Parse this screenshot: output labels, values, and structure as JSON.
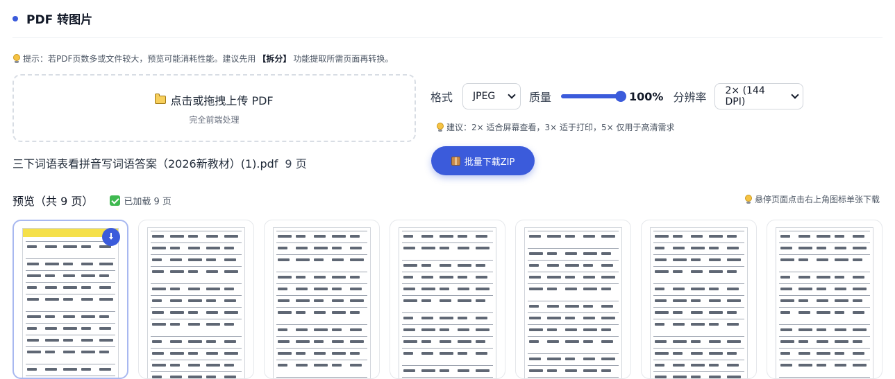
{
  "header": {
    "title": "PDF 转图片"
  },
  "tip": {
    "prefix": "提示：若PDF页数多或文件较大，预览可能消耗性能。建议先用",
    "keyword": "【拆分】",
    "suffix": "功能提取所需页面再转换。"
  },
  "upload": {
    "title": "点击或拖拽上传 PDF",
    "subtitle": "完全前端处理"
  },
  "file": {
    "name": "三下词语表看拼音写词语答案（2026新教材）(1).pdf",
    "pages": "9 页"
  },
  "settings": {
    "format_label": "格式",
    "format_value": "JPEG",
    "quality_label": "质量",
    "quality_percent": 100,
    "quality_text": "100%",
    "resolution_label": "分辨率",
    "resolution_value": "2× (144 DPI)"
  },
  "resolution_tip": "建议：2× 适合屏幕查看，3× 适于打印，5× 仅用于高清需求",
  "zip_button": "批量下载ZIP",
  "preview": {
    "title": "预览（共 9 页）",
    "loaded": "已加载 9 页",
    "hover_tip": "悬停页面点击右上角图标单张下载",
    "page_count_visible": 7
  },
  "colors": {
    "accent": "#3b5bdb",
    "success": "#3fb950",
    "banner": "#f5e04a"
  }
}
